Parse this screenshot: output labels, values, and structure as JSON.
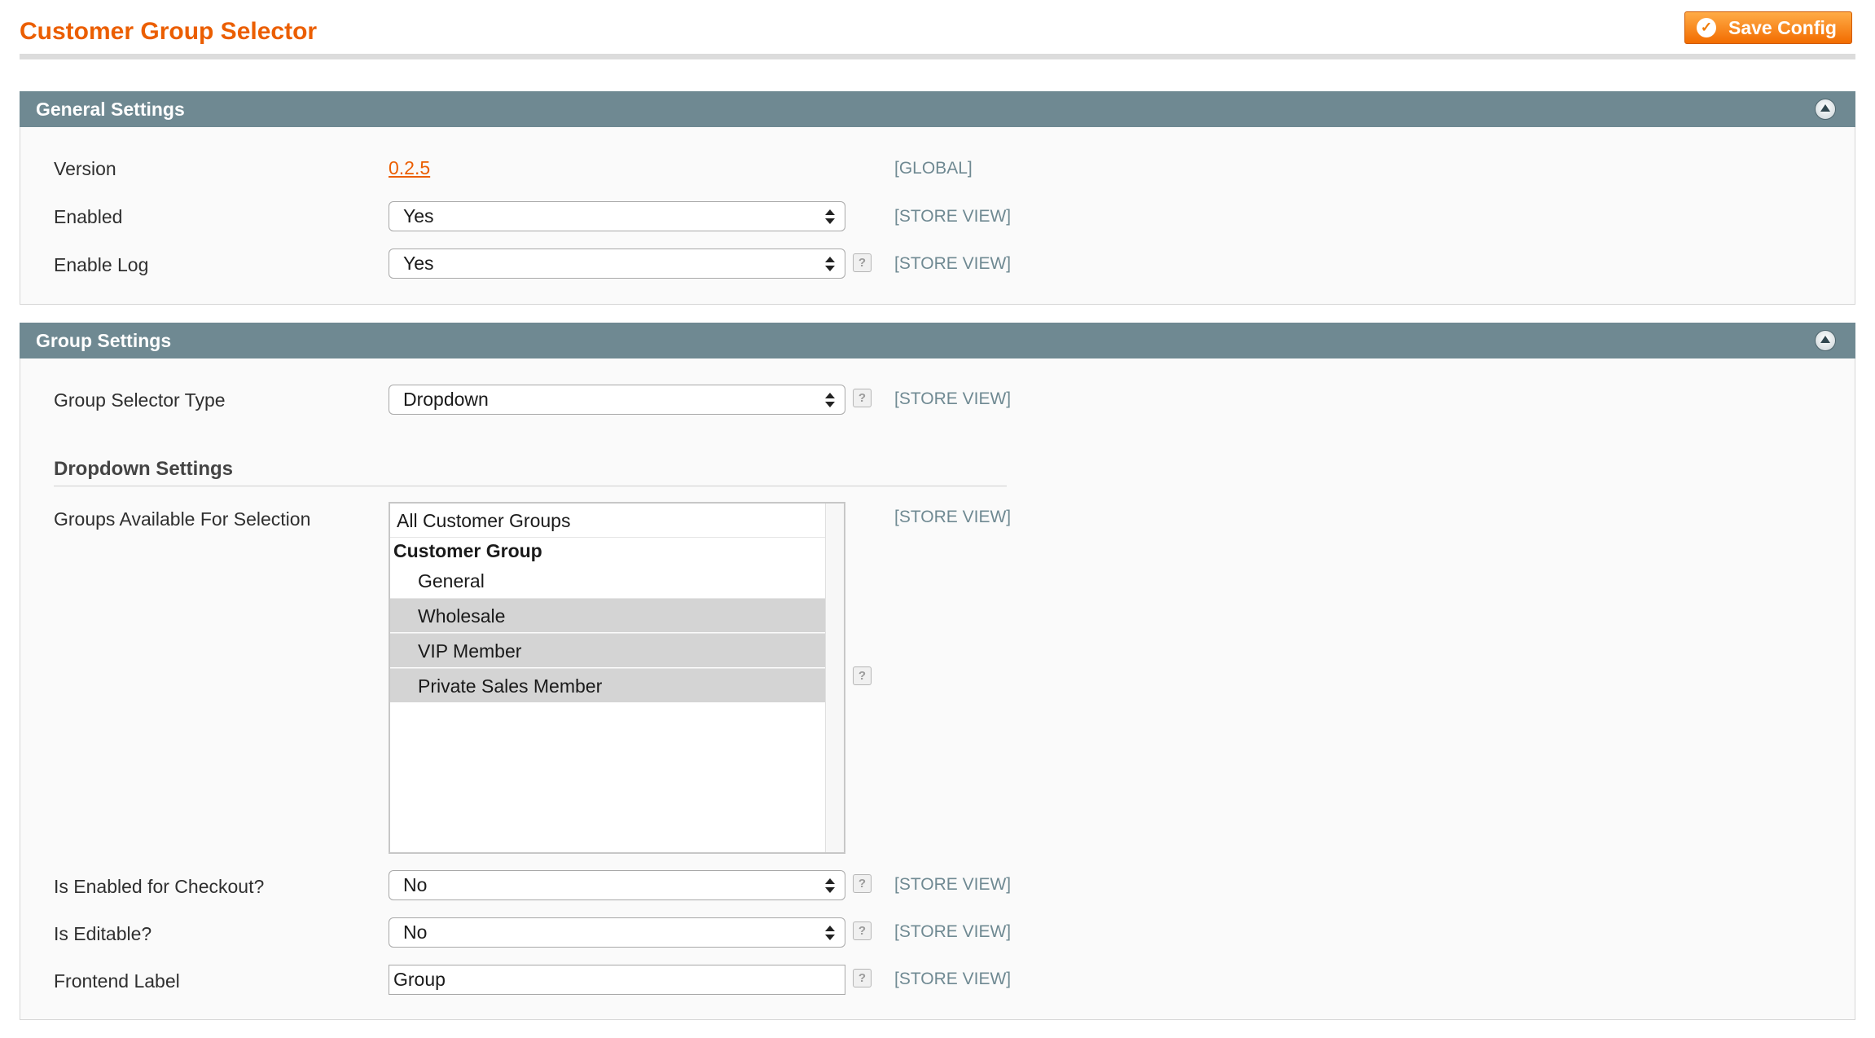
{
  "page": {
    "title": "Customer Group Selector",
    "save_label": "Save Config"
  },
  "general": {
    "title": "General Settings",
    "version_label": "Version",
    "version_value": "0.2.5",
    "version_scope": "[GLOBAL]",
    "enabled_label": "Enabled",
    "enabled_value": "Yes",
    "enabled_scope": "[STORE VIEW]",
    "log_label": "Enable Log",
    "log_value": "Yes",
    "log_scope": "[STORE VIEW]"
  },
  "group": {
    "title": "Group Settings",
    "type_label": "Group Selector Type",
    "type_value": "Dropdown",
    "type_scope": "[STORE VIEW]",
    "dropdown_title": "Dropdown Settings",
    "available_label": "Groups Available For Selection",
    "available_scope": "[STORE VIEW]",
    "available_all": "All Customer Groups",
    "available_group": "Customer Group",
    "available_items": [
      "General",
      "Wholesale",
      "VIP Member",
      "Private Sales Member"
    ],
    "checkout_label": "Is Enabled for Checkout?",
    "checkout_value": "No",
    "checkout_scope": "[STORE VIEW]",
    "editable_label": "Is Editable?",
    "editable_value": "No",
    "editable_scope": "[STORE VIEW]",
    "frontend_label": "Frontend Label",
    "frontend_value": "Group",
    "frontend_scope": "[STORE VIEW]"
  },
  "help_glyph": "?",
  "check_glyph": "✓"
}
